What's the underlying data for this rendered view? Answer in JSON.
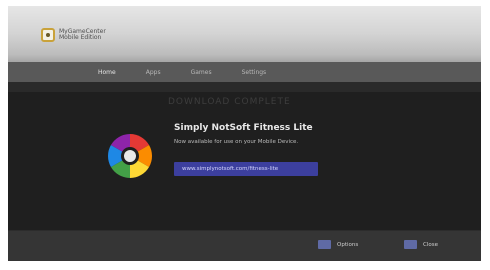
{
  "app": {
    "name": "MyGameCenter",
    "subtitle": "Mobile Edition"
  },
  "nav": {
    "items": [
      "Home",
      "Apps",
      "Games",
      "Settings"
    ]
  },
  "promo": {
    "headline": "DOWNLOAD COMPLETE",
    "title": "Simply NotSoft Fitness Lite",
    "subtitle": "Now available for use on your Mobile Device.",
    "link_text": "www.simplynotsoft.com/fitness-lite"
  },
  "footer": {
    "left_label": "Options",
    "right_label": "Close"
  },
  "colors": {
    "link_bg": "#3c3f9e",
    "footer_icon": "#5f6aa5"
  }
}
